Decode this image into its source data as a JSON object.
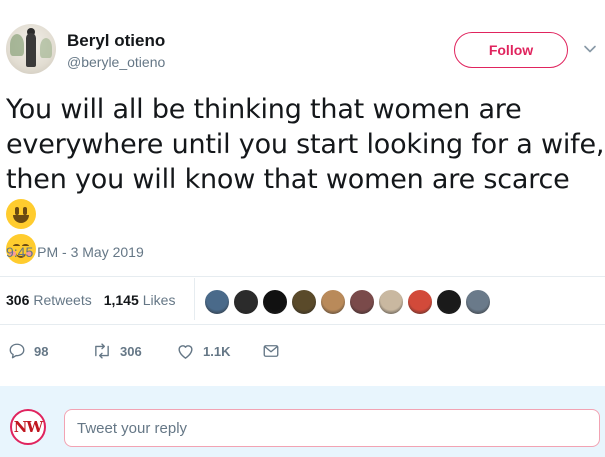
{
  "author": {
    "display_name": "Beryl otieno",
    "handle": "@beryle_otieno",
    "avatar_icon": "profile-photo"
  },
  "follow_button": {
    "label": "Follow",
    "color": "#e0245e"
  },
  "menu_icon": "chevron-down-icon",
  "tweet": {
    "text_line1": "You will all be thinking that women are",
    "text_line2": "everywhere until you start looking for a wife,",
    "text_line3": "then you will know that women are scarce",
    "emojis": [
      "grinning-face",
      "smiling-face-with-smiling-eyes"
    ],
    "timestamp": "9:45 PM - 3 May 2019"
  },
  "stats": {
    "retweets_count": "306",
    "retweets_label": "Retweets",
    "likes_count": "1,145",
    "likes_label": "Likes"
  },
  "likers": [
    "#4a6a8a",
    "#2b2b2b",
    "#111111",
    "#5a4a2a",
    "#b98a5a",
    "#7a4a4a",
    "#c9b8a0",
    "#d24a3a",
    "#1a1a1a",
    "#6a7a8a"
  ],
  "actions": {
    "reply_count": "98",
    "retweet_count": "306",
    "like_count": "1.1K"
  },
  "reply": {
    "avatar_text": "NW",
    "placeholder": "Tweet your reply"
  },
  "colors": {
    "text_primary": "#14171a",
    "text_secondary": "#657786",
    "reply_background": "#e8f5fd"
  }
}
